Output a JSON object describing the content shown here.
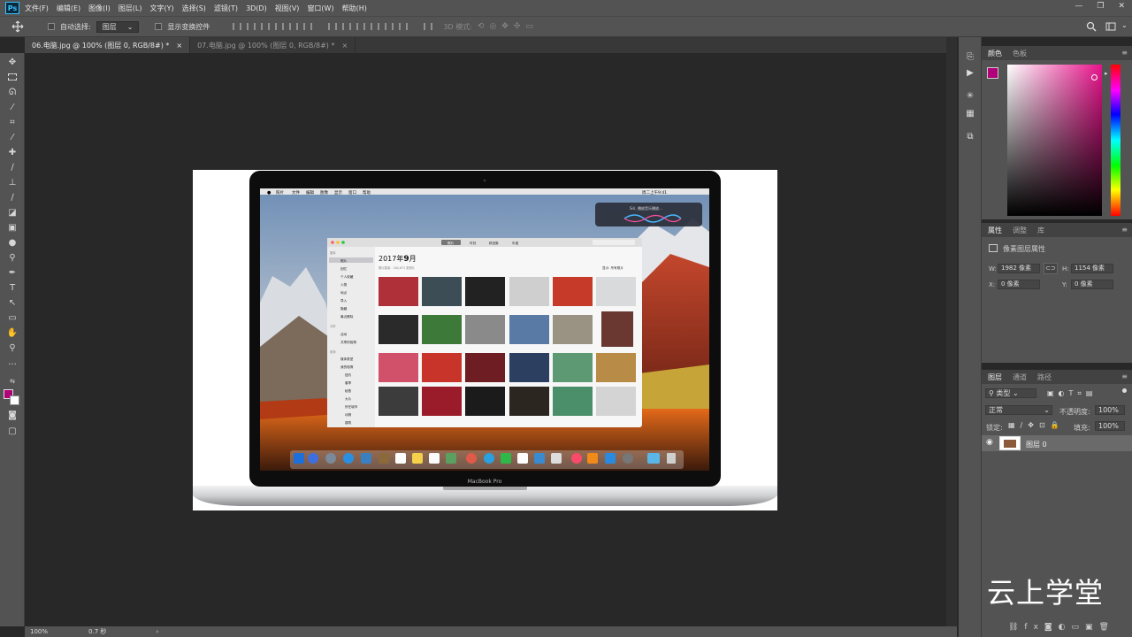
{
  "app": {
    "logo_text": "Ps"
  },
  "menubar": {
    "items": [
      "文件(F)",
      "编辑(E)",
      "图像(I)",
      "图层(L)",
      "文字(Y)",
      "选择(S)",
      "滤镜(T)",
      "3D(D)",
      "视图(V)",
      "窗口(W)",
      "帮助(H)"
    ],
    "window_controls": [
      "—",
      "❐",
      "✕"
    ]
  },
  "options": {
    "auto_select_label": "自动选择:",
    "auto_select_value": "图层",
    "show_transform_label": "显示变换控件",
    "mode_3d_label": "3D 模式:"
  },
  "tabs": [
    {
      "label": "06.电脑.jpg @ 100% (图层 0, RGB/8#) *",
      "close": "×",
      "active": true
    },
    {
      "label": "07.电脑.jpg @ 100% (图层 0, RGB/8#) *",
      "close": "×",
      "active": false
    }
  ],
  "status": {
    "zoom": "100%",
    "timing": "0.7 秒",
    "arrow": "›"
  },
  "color_panel": {
    "tabs": [
      "颜色",
      "色板"
    ],
    "foreground": "#b0007a",
    "background": "#ffffff",
    "hue_base": "#e8148c"
  },
  "properties_panel": {
    "tabs": [
      "属性",
      "调整",
      "库"
    ],
    "title": "像素图层属性",
    "w_label": "W:",
    "w_value": "1982 像素",
    "h_label": "H:",
    "h_value": "1154 像素",
    "x_label": "X:",
    "x_value": "0 像素",
    "y_label": "Y:",
    "y_value": "0 像素"
  },
  "layers_panel": {
    "tabs": [
      "图层",
      "通道",
      "路径"
    ],
    "filter_value": "类型",
    "blend_mode": "正常",
    "opacity_label": "不透明度:",
    "opacity_value": "100%",
    "lock_label": "锁定:",
    "fill_label": "填充:",
    "fill_value": "100%",
    "layer_name": "图层 0"
  },
  "document": {
    "laptop_label": "MacBook Pro",
    "mac_menu": [
      "照片",
      "文件",
      "编辑",
      "图像",
      "显示",
      "窗口",
      "帮助"
    ],
    "mac_clock": "周二上午9:41",
    "siri_text": "Siri, 播放音乐播放...",
    "photos": {
      "title_year": "2017年",
      "title_month": "9",
      "title_unit": "月",
      "subtitle": "照片数量：164,673 张照片",
      "segments": [
        "照片",
        "时刻",
        "精选集",
        "年度"
      ],
      "show_label": "显示:",
      "show_value": "所有照片",
      "sidebar_header_library": "图库",
      "sidebar_library": [
        "照片",
        "回忆",
        "个人收藏",
        "人物",
        "地点",
        "导入",
        "隐藏",
        "最近删除"
      ],
      "sidebar_header_shared": "共享",
      "sidebar_shared": [
        "活动",
        "共享的相簿"
      ],
      "sidebar_header_albums": "相簿",
      "sidebar_albums": [
        "媒体类型",
        "我的相簿",
        "纽约",
        "春季",
        "秘鲁",
        "大片",
        "所在城市",
        "动物",
        "建筑"
      ]
    }
  },
  "watermark": "云上学堂"
}
